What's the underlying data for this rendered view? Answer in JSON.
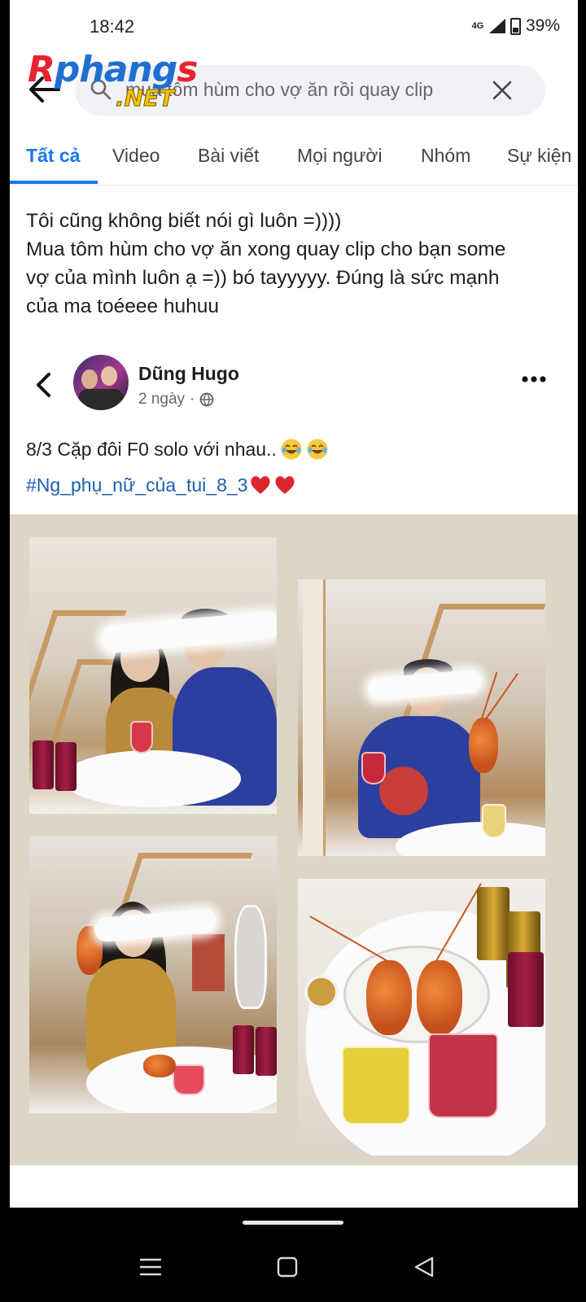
{
  "status_bar": {
    "time": "18:42",
    "network": "4G",
    "battery": "39%"
  },
  "watermark": {
    "name": "Rphangs",
    "suffix": ".NET"
  },
  "search": {
    "query": "mua tôm hùm cho vợ ăn rồi quay clip"
  },
  "tabs": [
    {
      "label": "Tất cả",
      "active": true
    },
    {
      "label": "Video"
    },
    {
      "label": "Bài viết"
    },
    {
      "label": "Mọi người"
    },
    {
      "label": "Nhóm"
    },
    {
      "label": "Sự kiện"
    }
  ],
  "caption": {
    "line1": "Tôi cũng không biết nói gì luôn =))))",
    "line2": "Mua tôm hùm cho vợ ăn xong quay clip cho bạn some",
    "line3": "vợ của mình luôn ạ =))  bó tayyyyy. Đúng là sức mạnh",
    "line4": "của ma toéeee huhuu"
  },
  "post": {
    "author": "Dũng Hugo",
    "time": "2 ngày",
    "separator": "·",
    "text": "8/3 Cặp đôi F0 solo với nhau..",
    "hashtag": "#Ng_phụ_nữ_của_tui_8_3",
    "emoji_after_text": "laughing-emoji",
    "emoji_after_hashtag": "heart-emoji"
  },
  "colors": {
    "accent": "#1877f2",
    "hashtag": "#1a5fb4",
    "collage_bg": "#ddd6c6"
  }
}
